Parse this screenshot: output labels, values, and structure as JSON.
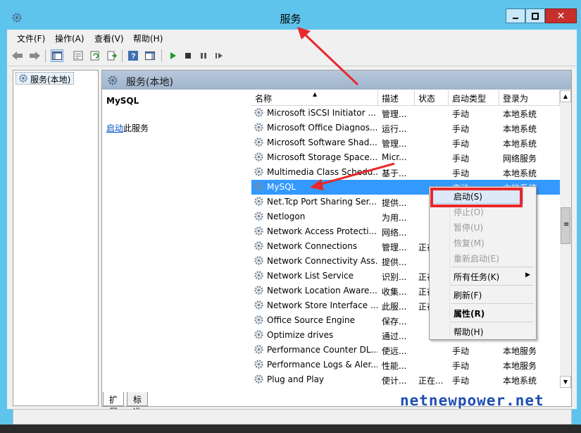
{
  "window": {
    "title": "服务"
  },
  "menu": [
    "文件(F)",
    "操作(A)",
    "查看(V)",
    "帮助(H)"
  ],
  "toolbar_icons": [
    "back-arrow-icon",
    "forward-arrow-icon",
    "show-hide-console-tree-icon",
    "properties-icon",
    "refresh-icon",
    "export-list-icon",
    "help-icon",
    "show-action-pane-icon",
    "start-service-icon",
    "stop-service-icon",
    "pause-service-icon",
    "restart-service-icon"
  ],
  "tree": {
    "root_label": "服务(本地)"
  },
  "panel": {
    "header_title": "服务(本地)",
    "selected_service_name": "MySQL",
    "start_link": "启动",
    "start_link_suffix": "此服务"
  },
  "columns": [
    "名称",
    "描述",
    "状态",
    "启动类型",
    "登录为"
  ],
  "services": [
    {
      "name": "Microsoft iSCSI Initiator ...",
      "desc": "管理...",
      "status": "",
      "start": "手动",
      "logon": "本地系统"
    },
    {
      "name": "Microsoft Office Diagnos...",
      "desc": "运行...",
      "status": "",
      "start": "手动",
      "logon": "本地系统"
    },
    {
      "name": "Microsoft Software Shad...",
      "desc": "管理...",
      "status": "",
      "start": "手动",
      "logon": "本地系统"
    },
    {
      "name": "Microsoft Storage Space...",
      "desc": "Micr...",
      "status": "",
      "start": "手动",
      "logon": "网络服务"
    },
    {
      "name": "Multimedia Class Schedu...",
      "desc": "基于...",
      "status": "",
      "start": "手动",
      "logon": "本地系统"
    },
    {
      "name": "MySQL",
      "desc": "",
      "status": "",
      "start": "启动",
      "logon": "本地系统",
      "selected": true
    },
    {
      "name": "Net.Tcp Port Sharing Ser...",
      "desc": "提供...",
      "status": "",
      "start": "",
      "logon": ""
    },
    {
      "name": "Netlogon",
      "desc": "为用...",
      "status": "",
      "start": "",
      "logon": ""
    },
    {
      "name": "Network Access Protecti...",
      "desc": "网络...",
      "status": "",
      "start": "",
      "logon": ""
    },
    {
      "name": "Network Connections",
      "desc": "管理...",
      "status": "正在",
      "start": "",
      "logon": ""
    },
    {
      "name": "Network Connectivity Ass...",
      "desc": "提供...",
      "status": "",
      "start": "",
      "logon": ""
    },
    {
      "name": "Network List Service",
      "desc": "识别...",
      "status": "正在",
      "start": "",
      "logon": ""
    },
    {
      "name": "Network Location Aware...",
      "desc": "收集...",
      "status": "正在",
      "start": "",
      "logon": ""
    },
    {
      "name": "Network Store Interface ...",
      "desc": "此服...",
      "status": "正在",
      "start": "",
      "logon": ""
    },
    {
      "name": "Office Source Engine",
      "desc": "保存...",
      "status": "",
      "start": "",
      "logon": ""
    },
    {
      "name": "Optimize drives",
      "desc": "通过...",
      "status": "",
      "start": "",
      "logon": ""
    },
    {
      "name": "Performance Counter DL...",
      "desc": "使远...",
      "status": "",
      "start": "手动",
      "logon": "本地服务"
    },
    {
      "name": "Performance Logs & Aler...",
      "desc": "性能...",
      "status": "",
      "start": "手动",
      "logon": "本地服务"
    },
    {
      "name": "Plug and Play",
      "desc": "使计...",
      "status": "正在...",
      "start": "手动",
      "logon": "本地系统"
    }
  ],
  "context_menu": {
    "start": "启动(S)",
    "stop": "停止(O)",
    "pause": "暂停(U)",
    "resume": "恢复(M)",
    "restart": "重新启动(E)",
    "all_tasks": "所有任务(K)",
    "refresh": "刷新(F)",
    "properties": "属性(R)",
    "help": "帮助(H)"
  },
  "tabs": [
    "扩展",
    "标准"
  ],
  "watermark": "netnewpower.net",
  "colors": {
    "title_bar": "#5fc4ec",
    "selection": "#3399ff",
    "annotation": "#e8282c",
    "close_button": "#c7302a"
  }
}
